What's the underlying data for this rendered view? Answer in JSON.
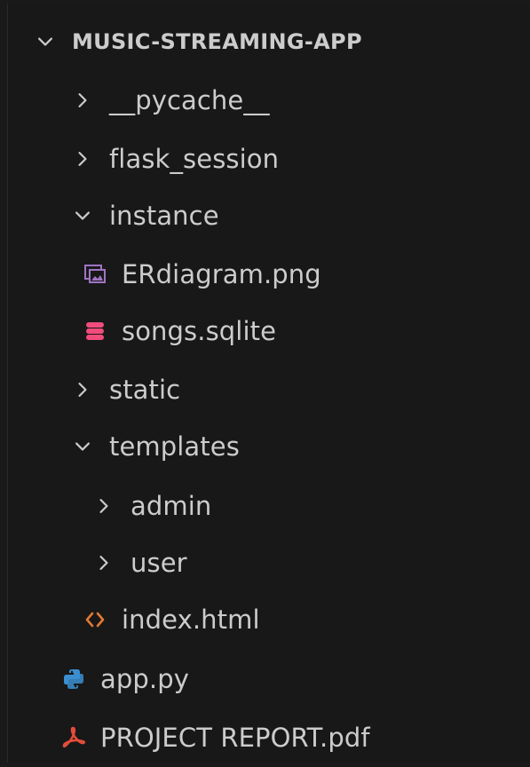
{
  "explorer": {
    "root_label": "MUSIC-STREAMING-APP",
    "items": [
      {
        "label": "__pycache__",
        "icon": "chevron-right-icon"
      },
      {
        "label": "flask_session",
        "icon": "chevron-right-icon"
      },
      {
        "label": "instance",
        "icon": "chevron-down-icon"
      },
      {
        "label": "ERdiagram.png",
        "icon": "image-file-icon"
      },
      {
        "label": "songs.sqlite",
        "icon": "database-icon"
      },
      {
        "label": "static",
        "icon": "chevron-right-icon"
      },
      {
        "label": "templates",
        "icon": "chevron-down-icon"
      },
      {
        "label": "admin",
        "icon": "chevron-right-icon"
      },
      {
        "label": "user",
        "icon": "chevron-right-icon"
      },
      {
        "label": "index.html",
        "icon": "html-file-icon"
      },
      {
        "label": "app.py",
        "icon": "python-file-icon"
      },
      {
        "label": "PROJECT REPORT.pdf",
        "icon": "pdf-file-icon"
      }
    ]
  },
  "colors": {
    "background": "#181818",
    "text": "#cccccc",
    "image_icon": "#a074c4",
    "database_icon": "#f14c7c",
    "html_icon": "#e37933",
    "python_icon": "#3b8fd1",
    "pdf_icon": "#e44d3a"
  }
}
